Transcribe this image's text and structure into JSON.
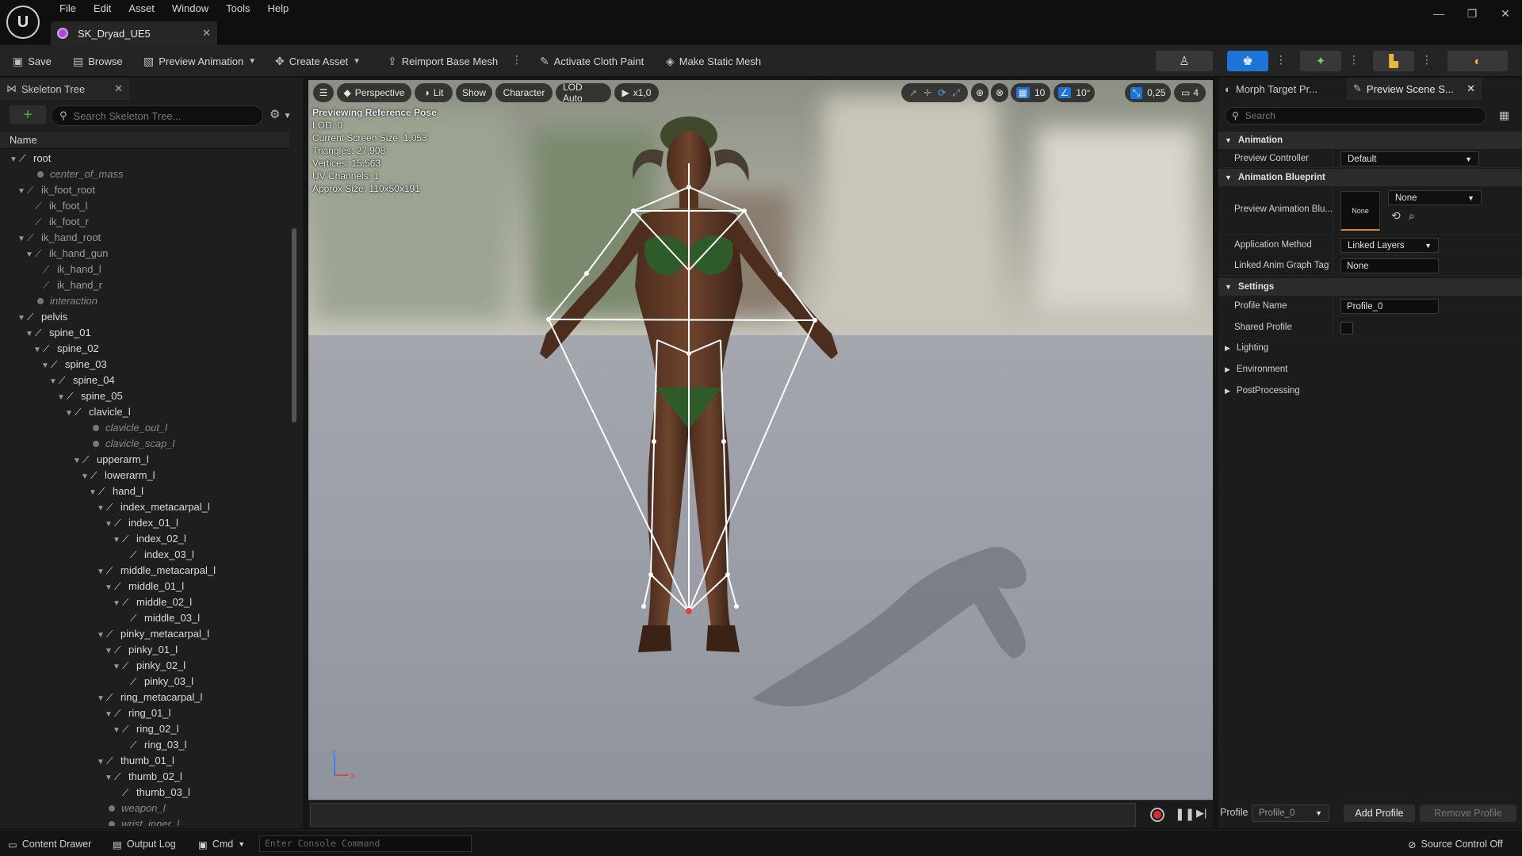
{
  "app": {
    "logo_text": "U",
    "document_tab": "SK_Dryad_UE5"
  },
  "menu": [
    "File",
    "Edit",
    "Asset",
    "Window",
    "Tools",
    "Help"
  ],
  "window_controls": {
    "minimize": "—",
    "restore": "❐",
    "close": "✕"
  },
  "toolbar": {
    "save": "Save",
    "browse": "Browse",
    "preview_animation": "Preview Animation",
    "create_asset": "Create Asset",
    "reimport_base_mesh": "Reimport Base Mesh",
    "activate_cloth_paint": "Activate Cloth Paint",
    "make_static_mesh": "Make Static Mesh"
  },
  "skeleton_tree": {
    "tab_label": "Skeleton Tree",
    "search_placeholder": "Search Skeleton Tree...",
    "column_name": "Name",
    "rows": [
      {
        "label": "root",
        "indent": 0,
        "kind": "bone",
        "expanded": true
      },
      {
        "label": "center_of_mass",
        "indent": 2,
        "kind": "socket"
      },
      {
        "label": "ik_foot_root",
        "indent": 1,
        "kind": "bone-dim",
        "expanded": true
      },
      {
        "label": "ik_foot_l",
        "indent": 2,
        "kind": "bone-dim"
      },
      {
        "label": "ik_foot_r",
        "indent": 2,
        "kind": "bone-dim"
      },
      {
        "label": "ik_hand_root",
        "indent": 1,
        "kind": "bone-dim",
        "expanded": true
      },
      {
        "label": "ik_hand_gun",
        "indent": 2,
        "kind": "bone-dim",
        "expanded": true
      },
      {
        "label": "ik_hand_l",
        "indent": 3,
        "kind": "bone-dim"
      },
      {
        "label": "ik_hand_r",
        "indent": 3,
        "kind": "bone-dim"
      },
      {
        "label": "interaction",
        "indent": 2,
        "kind": "socket"
      },
      {
        "label": "pelvis",
        "indent": 1,
        "kind": "bone",
        "expanded": true
      },
      {
        "label": "spine_01",
        "indent": 2,
        "kind": "bone",
        "expanded": true
      },
      {
        "label": "spine_02",
        "indent": 3,
        "kind": "bone",
        "expanded": true
      },
      {
        "label": "spine_03",
        "indent": 4,
        "kind": "bone",
        "expanded": true
      },
      {
        "label": "spine_04",
        "indent": 5,
        "kind": "bone",
        "expanded": true
      },
      {
        "label": "spine_05",
        "indent": 6,
        "kind": "bone",
        "expanded": true
      },
      {
        "label": "clavicle_l",
        "indent": 7,
        "kind": "bone",
        "expanded": true
      },
      {
        "label": "clavicle_out_l",
        "indent": 9,
        "kind": "socket"
      },
      {
        "label": "clavicle_scap_l",
        "indent": 9,
        "kind": "socket"
      },
      {
        "label": "upperarm_l",
        "indent": 8,
        "kind": "bone",
        "expanded": true
      },
      {
        "label": "lowerarm_l",
        "indent": 9,
        "kind": "bone",
        "expanded": true
      },
      {
        "label": "hand_l",
        "indent": 10,
        "kind": "bone",
        "expanded": true
      },
      {
        "label": "index_metacarpal_l",
        "indent": 11,
        "kind": "bone",
        "expanded": true
      },
      {
        "label": "index_01_l",
        "indent": 12,
        "kind": "bone",
        "expanded": true
      },
      {
        "label": "index_02_l",
        "indent": 13,
        "kind": "bone",
        "expanded": true
      },
      {
        "label": "index_03_l",
        "indent": 14,
        "kind": "bone"
      },
      {
        "label": "middle_metacarpal_l",
        "indent": 11,
        "kind": "bone",
        "expanded": true
      },
      {
        "label": "middle_01_l",
        "indent": 12,
        "kind": "bone",
        "expanded": true
      },
      {
        "label": "middle_02_l",
        "indent": 13,
        "kind": "bone",
        "expanded": true
      },
      {
        "label": "middle_03_l",
        "indent": 14,
        "kind": "bone"
      },
      {
        "label": "pinky_metacarpal_l",
        "indent": 11,
        "kind": "bone",
        "expanded": true
      },
      {
        "label": "pinky_01_l",
        "indent": 12,
        "kind": "bone",
        "expanded": true
      },
      {
        "label": "pinky_02_l",
        "indent": 13,
        "kind": "bone",
        "expanded": true
      },
      {
        "label": "pinky_03_l",
        "indent": 14,
        "kind": "bone"
      },
      {
        "label": "ring_metacarpal_l",
        "indent": 11,
        "kind": "bone",
        "expanded": true
      },
      {
        "label": "ring_01_l",
        "indent": 12,
        "kind": "bone",
        "expanded": true
      },
      {
        "label": "ring_02_l",
        "indent": 13,
        "kind": "bone",
        "expanded": true
      },
      {
        "label": "ring_03_l",
        "indent": 14,
        "kind": "bone"
      },
      {
        "label": "thumb_01_l",
        "indent": 11,
        "kind": "bone",
        "expanded": true
      },
      {
        "label": "thumb_02_l",
        "indent": 12,
        "kind": "bone",
        "expanded": true
      },
      {
        "label": "thumb_03_l",
        "indent": 13,
        "kind": "bone"
      },
      {
        "label": "weapon_l",
        "indent": 11,
        "kind": "socket"
      },
      {
        "label": "wrist_inner_l",
        "indent": 11,
        "kind": "socket"
      }
    ]
  },
  "viewport": {
    "perspective": "Perspective",
    "lit": "Lit",
    "show": "Show",
    "character": "Character",
    "lod": "LOD Auto",
    "play_rate": "x1,0",
    "grid_snap": "10",
    "rotation_snap": "10°",
    "scale_snap": "0,25",
    "camera_speed": "4",
    "info": {
      "line1": "Previewing Reference Pose",
      "line2": "LOD: 0",
      "line3": "Current Screen Size: 1,053",
      "line4": "Triangles: 27,908",
      "line5": "Vertices: 15,563",
      "line6": "UV Channels: 1",
      "line7": "Approx Size: 110x50x191"
    },
    "axis_z": "z",
    "axis_x": "x"
  },
  "details": {
    "tab_morph": "Morph Target Pr...",
    "tab_preview": "Preview Scene S...",
    "search_placeholder": "Search",
    "sections": {
      "animation": "Animation",
      "animation_blueprint": "Animation Blueprint",
      "settings": "Settings",
      "lighting": "Lighting",
      "environment": "Environment",
      "postprocessing": "PostProcessing"
    },
    "props": {
      "preview_controller_label": "Preview Controller",
      "preview_controller_value": "Default",
      "preview_anim_bp_label": "Preview Animation Blu...",
      "preview_anim_bp_thumb": "None",
      "preview_anim_bp_value": "None",
      "application_method_label": "Application Method",
      "application_method_value": "Linked Layers",
      "linked_anim_graph_tag_label": "Linked Anim Graph Tag",
      "linked_anim_graph_tag_value": "None",
      "profile_name_label": "Profile Name",
      "profile_name_value": "Profile_0",
      "shared_profile_label": "Shared Profile"
    },
    "profile_bar": {
      "label": "Profile",
      "value": "Profile_0",
      "add": "Add Profile",
      "remove": "Remove Profile"
    }
  },
  "statusbar": {
    "content_drawer": "Content Drawer",
    "output_log": "Output Log",
    "cmd": "Cmd",
    "console_placeholder": "Enter Console Command",
    "source_control": "Source Control Off"
  },
  "colors": {
    "accent_blue": "#1d73d8",
    "add_green": "#36b24a",
    "record_red": "#d32f2f",
    "thumb_orange": "#d8872d"
  }
}
